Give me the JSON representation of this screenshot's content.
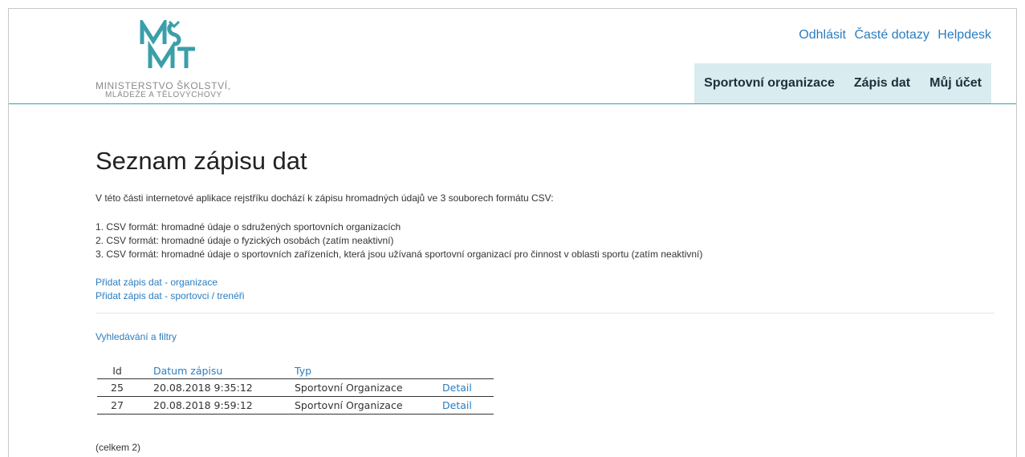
{
  "header": {
    "logo_line1": "MINISTERSTVO ŠKOLSTVÍ,",
    "logo_line2": "MLÁDEŽE A TĚLOVÝCHOVY",
    "top_links": {
      "logout": "Odhlásit",
      "faq": "Časté dotazy",
      "helpdesk": "Helpdesk"
    },
    "nav": {
      "organizations": "Sportovní organizace",
      "data_entry": "Zápis dat",
      "account": "Můj účet"
    },
    "colors": {
      "accent": "#3a9fa8",
      "nav_bg": "#d9ecef",
      "link": "#2a7dc0"
    }
  },
  "main": {
    "title": "Seznam zápisu dat",
    "intro": "V této části internetové aplikace rejstříku dochází k zápisu hromadných údajů ve 3 souborech formátu CSV:",
    "list": [
      "1. CSV formát: hromadné údaje o sdružených sportovních organizacích",
      "2. CSV formát: hromadné údaje o fyzických osobách (zatím neaktivní)",
      "3. CSV formát: hromadné údaje o sportovních zařízeních, která jsou užívaná sportovní organizací pro činnost v oblasti sportu (zatím neaktivní)"
    ],
    "add_links": [
      "Přidat zápis dat - organizace",
      "Přidat zápis dat - sportovci / trenéři"
    ],
    "filters_link": "Vyhledávání a filtry",
    "table": {
      "headers": {
        "id": "Id",
        "date": "Datum zápisu",
        "type": "Typ"
      },
      "rows": [
        {
          "id": "25",
          "date": "20.08.2018 9:35:12",
          "type": "Sportovní Organizace",
          "detail": "Detail"
        },
        {
          "id": "27",
          "date": "20.08.2018 9:59:12",
          "type": "Sportovní Organizace",
          "detail": "Detail"
        }
      ]
    },
    "total": "(celkem 2)"
  }
}
